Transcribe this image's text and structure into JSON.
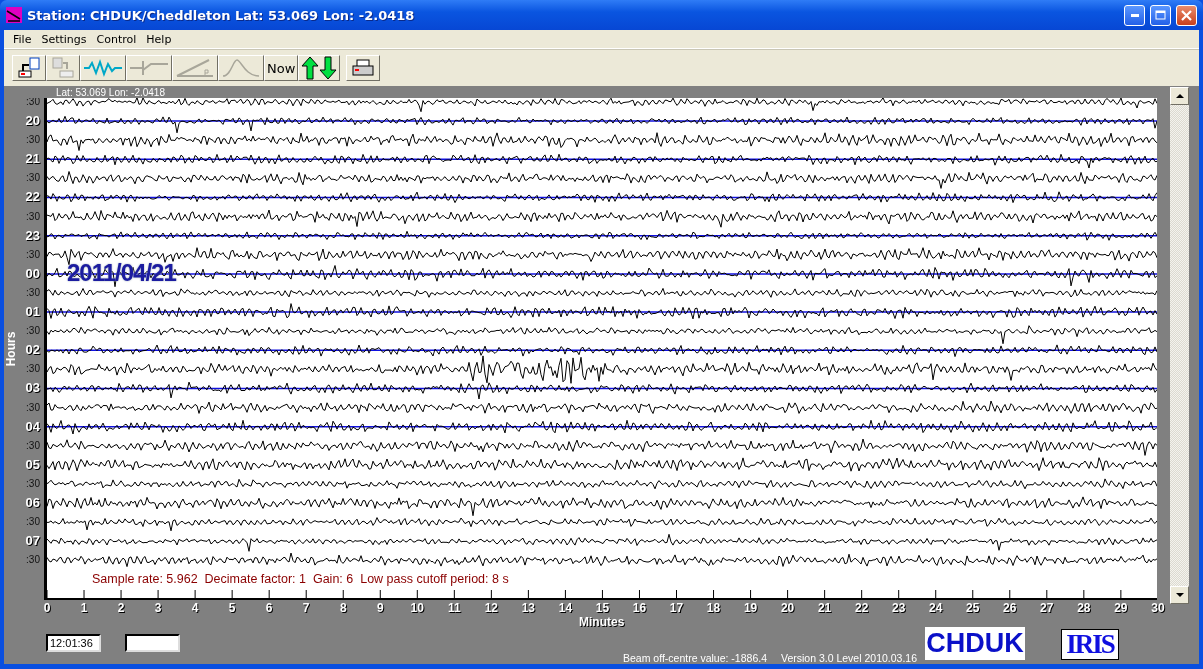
{
  "window": {
    "title": "Station: CHDUK/Cheddleton Lat: 53.069 Lon: -2.0418"
  },
  "menu": [
    "File",
    "Settings",
    "Control",
    "Help"
  ],
  "toolbar": [
    {
      "kind": "open",
      "disabled": false
    },
    {
      "kind": "paste",
      "disabled": true
    },
    {
      "kind": "wave",
      "disabled": false
    },
    {
      "kind": "filter",
      "disabled": true
    },
    {
      "kind": "slope",
      "disabled": true
    },
    {
      "kind": "peak",
      "disabled": true
    },
    {
      "kind": "now",
      "label": "Now",
      "disabled": false
    },
    {
      "kind": "updown",
      "disabled": false
    },
    {
      "kind": "print",
      "disabled": false
    }
  ],
  "plot": {
    "header": "Lat: 53.069 Lon: -2.0418",
    "axis_title": "Hours",
    "date": "2011/04/21",
    "info": "Sample rate: 5.962  Decimate factor: 1  Gain: 6  Low pass cutoff period: 8 s",
    "x_title": "Minutes",
    "rows": [
      {
        "kind": "half",
        "label": ":30",
        "baseline": false
      },
      {
        "kind": "hour",
        "label": "20",
        "baseline": true
      },
      {
        "kind": "half",
        "label": ":30",
        "baseline": false
      },
      {
        "kind": "hour",
        "label": "21",
        "baseline": true
      },
      {
        "kind": "half",
        "label": ":30",
        "baseline": false
      },
      {
        "kind": "hour",
        "label": "22",
        "baseline": true
      },
      {
        "kind": "half",
        "label": ":30",
        "baseline": false
      },
      {
        "kind": "hour",
        "label": "23",
        "baseline": true
      },
      {
        "kind": "half",
        "label": ":30",
        "baseline": false
      },
      {
        "kind": "hour",
        "label": "00",
        "baseline": true
      },
      {
        "kind": "half",
        "label": ":30",
        "baseline": false
      },
      {
        "kind": "hour",
        "label": "01",
        "baseline": true
      },
      {
        "kind": "half",
        "label": ":30",
        "baseline": false
      },
      {
        "kind": "hour",
        "label": "02",
        "baseline": true
      },
      {
        "kind": "half",
        "label": ":30",
        "baseline": false
      },
      {
        "kind": "hour",
        "label": "03",
        "baseline": true
      },
      {
        "kind": "half",
        "label": ":30",
        "baseline": false
      },
      {
        "kind": "hour",
        "label": "04",
        "baseline": true
      },
      {
        "kind": "half",
        "label": ":30",
        "baseline": false
      },
      {
        "kind": "hour",
        "label": "05",
        "baseline": false
      },
      {
        "kind": "half",
        "label": ":30",
        "baseline": false
      },
      {
        "kind": "hour",
        "label": "06",
        "baseline": false
      },
      {
        "kind": "half",
        "label": ":30",
        "baseline": false
      },
      {
        "kind": "hour",
        "label": "07",
        "baseline": false
      },
      {
        "kind": "half",
        "label": ":30",
        "baseline": false
      }
    ],
    "x_ticks": [
      "0",
      "1",
      "2",
      "3",
      "4",
      "5",
      "6",
      "7",
      "8",
      "9",
      "10",
      "11",
      "12",
      "13",
      "14",
      "15",
      "16",
      "17",
      "18",
      "19",
      "20",
      "21",
      "22",
      "23",
      "24",
      "25",
      "26",
      "27",
      "28",
      "29",
      "30"
    ]
  },
  "status": {
    "time": "12:01:36",
    "beam": "Beam off-centre value: -1886.4",
    "version": "Version 3.0 Level 2010.03.16",
    "station_logo": "CHDUK",
    "network_logo": "IRIS"
  }
}
